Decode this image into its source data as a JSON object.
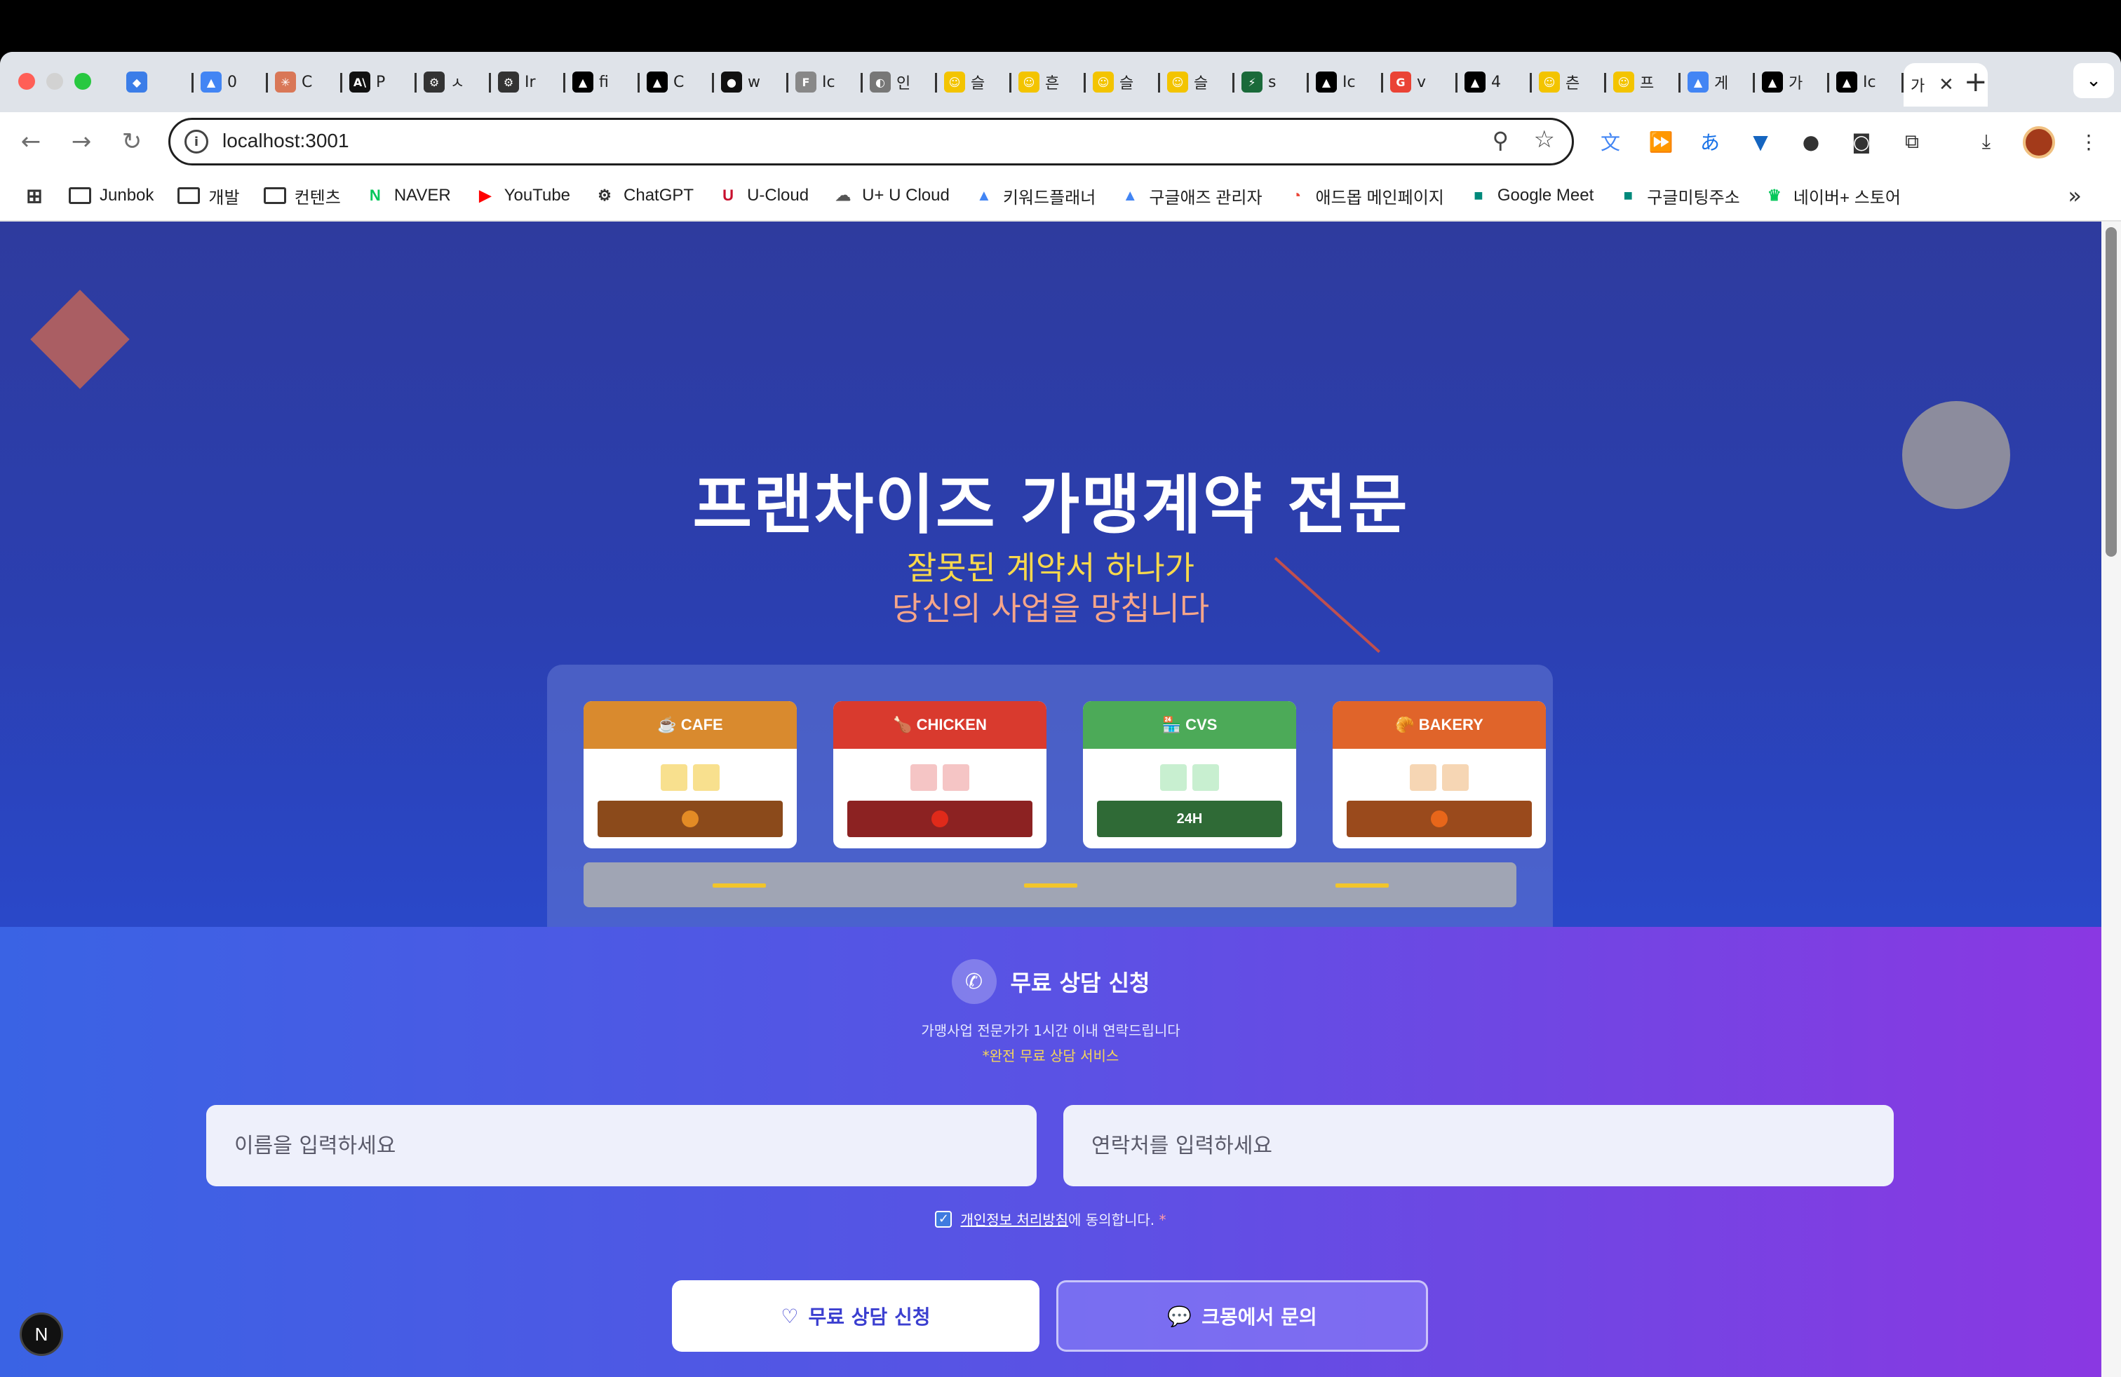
{
  "browser": {
    "tabs": [
      {
        "icon": "diamond-icon",
        "color": "#3b7de8",
        "glyph": "◆",
        "title": ""
      },
      {
        "icon": "google-ads-icon",
        "color": "#4285f4",
        "glyph": "▲",
        "title": "0"
      },
      {
        "icon": "claude-icon",
        "color": "#d97757",
        "glyph": "✳",
        "title": "C"
      },
      {
        "icon": "anthropic-icon",
        "color": "#111111",
        "glyph": "A\\",
        "title": "P"
      },
      {
        "icon": "openai-icon",
        "color": "#333333",
        "glyph": "⚙",
        "title": "ㅅ"
      },
      {
        "icon": "openai-icon",
        "color": "#333333",
        "glyph": "⚙",
        "title": "Ir"
      },
      {
        "icon": "vercel-icon",
        "color": "#000000",
        "glyph": "▲",
        "title": "fi"
      },
      {
        "icon": "vercel-icon",
        "color": "#000000",
        "glyph": "▲",
        "title": "C"
      },
      {
        "icon": "github-icon",
        "color": "#111111",
        "glyph": "●",
        "title": "w"
      },
      {
        "icon": "figma-icon",
        "color": "#888888",
        "glyph": "F",
        "title": "Ic"
      },
      {
        "icon": "globe-icon",
        "color": "#777777",
        "glyph": "◐",
        "title": "인"
      },
      {
        "icon": "emoji-icon",
        "color": "#f3c400",
        "glyph": "☺",
        "title": "슬"
      },
      {
        "icon": "emoji-icon",
        "color": "#f3c400",
        "glyph": "☺",
        "title": "흔"
      },
      {
        "icon": "emoji-icon",
        "color": "#f3c400",
        "glyph": "☺",
        "title": "슬"
      },
      {
        "icon": "emoji-icon",
        "color": "#f3c400",
        "glyph": "☺",
        "title": "슬"
      },
      {
        "icon": "bolt-icon",
        "color": "#1a6a3a",
        "glyph": "⚡",
        "title": "s"
      },
      {
        "icon": "vercel-icon",
        "color": "#000000",
        "glyph": "▲",
        "title": "Ic"
      },
      {
        "icon": "google-icon",
        "color": "#ea4335",
        "glyph": "G",
        "title": "v"
      },
      {
        "icon": "vercel-icon",
        "color": "#000000",
        "glyph": "▲",
        "title": "4"
      },
      {
        "icon": "emoji-icon",
        "color": "#f3c400",
        "glyph": "☺",
        "title": "츤"
      },
      {
        "icon": "emoji-icon",
        "color": "#f3c400",
        "glyph": "☺",
        "title": "프"
      },
      {
        "icon": "google-ads-icon",
        "color": "#4285f4",
        "glyph": "▲",
        "title": "게"
      },
      {
        "icon": "vercel-icon",
        "color": "#000000",
        "glyph": "▲",
        "title": "가"
      },
      {
        "icon": "vercel-icon",
        "color": "#000000",
        "glyph": "▲",
        "title": "Ic"
      }
    ],
    "active_tab_title": "가",
    "url": "localhost:3001",
    "bookmarks": [
      {
        "label": "Junbok",
        "icon": "folder-icon"
      },
      {
        "label": "개발",
        "icon": "folder-icon"
      },
      {
        "label": "컨텐츠",
        "icon": "folder-icon"
      },
      {
        "label": "NAVER",
        "icon": "naver-icon",
        "color": "#03c75a",
        "glyph": "N"
      },
      {
        "label": "YouTube",
        "icon": "youtube-icon",
        "color": "#ff0000",
        "glyph": "▶"
      },
      {
        "label": "ChatGPT",
        "icon": "openai-icon",
        "color": "#333333",
        "glyph": "⚙"
      },
      {
        "label": "U-Cloud",
        "icon": "ucloud-icon",
        "color": "#c8102e",
        "glyph": "U"
      },
      {
        "label": "U+ U Cloud",
        "icon": "cloud-icon",
        "color": "#555555",
        "glyph": "☁"
      },
      {
        "label": "키워드플래너",
        "icon": "google-ads-icon",
        "color": "#4285f4",
        "glyph": "▲"
      },
      {
        "label": "구글애즈 관리자",
        "icon": "google-ads-icon",
        "color": "#4285f4",
        "glyph": "▲"
      },
      {
        "label": "애드몹 메인페이지",
        "icon": "admob-icon",
        "color": "#ea4335",
        "glyph": "◔"
      },
      {
        "label": "Google Meet",
        "icon": "google-meet-icon",
        "color": "#00897b",
        "glyph": "■"
      },
      {
        "label": "구글미팅주소",
        "icon": "google-meet-icon",
        "color": "#00897b",
        "glyph": "■"
      },
      {
        "label": "네이버+ 스토어",
        "icon": "trophy-icon",
        "color": "#03c75a",
        "glyph": "♛"
      }
    ]
  },
  "hero": {
    "title": "프랜차이즈 가맹계약 전문",
    "subtitle_line1": "잘못된 계약서 하나가",
    "subtitle_line2": "당신의 사업을 망칩니다",
    "stores": [
      {
        "label": "☕ CAFE",
        "awning_color": "#d98a2e",
        "window_color": "#f8e08e",
        "door_color": "#8b4a1b",
        "knob_color": "#e38b25",
        "door_text": ""
      },
      {
        "label": "🍗 CHICKEN",
        "awning_color": "#d93a2e",
        "window_color": "#f5c5c5",
        "door_color": "#8c2222",
        "knob_color": "#e02a1a",
        "door_text": ""
      },
      {
        "label": "🏪 CVS",
        "awning_color": "#4caa58",
        "window_color": "#c8efd0",
        "door_color": "#2f6a36",
        "knob_color": "",
        "door_text": "24H"
      },
      {
        "label": "🥐 BAKERY",
        "awning_color": "#e0642a",
        "window_color": "#f6d6b4",
        "door_color": "#9a4a1c",
        "knob_color": "#e8661a",
        "door_text": ""
      }
    ]
  },
  "form": {
    "title": "무료 상담 신청",
    "description": "가맹사업 전문가가 1시간 이내 연락드립니다",
    "note": "*완전 무료 상담 서비스",
    "name_placeholder": "이름을 입력하세요",
    "phone_placeholder": "연락처를 입력하세요",
    "consent_link": "개인정보 처리방침",
    "consent_text": "에 동의합니다.",
    "consent_required": "*",
    "consent_checked": true,
    "primary_button": "무료 상담 신청",
    "secondary_button": "크몽에서 문의"
  },
  "dev_badge": "N"
}
